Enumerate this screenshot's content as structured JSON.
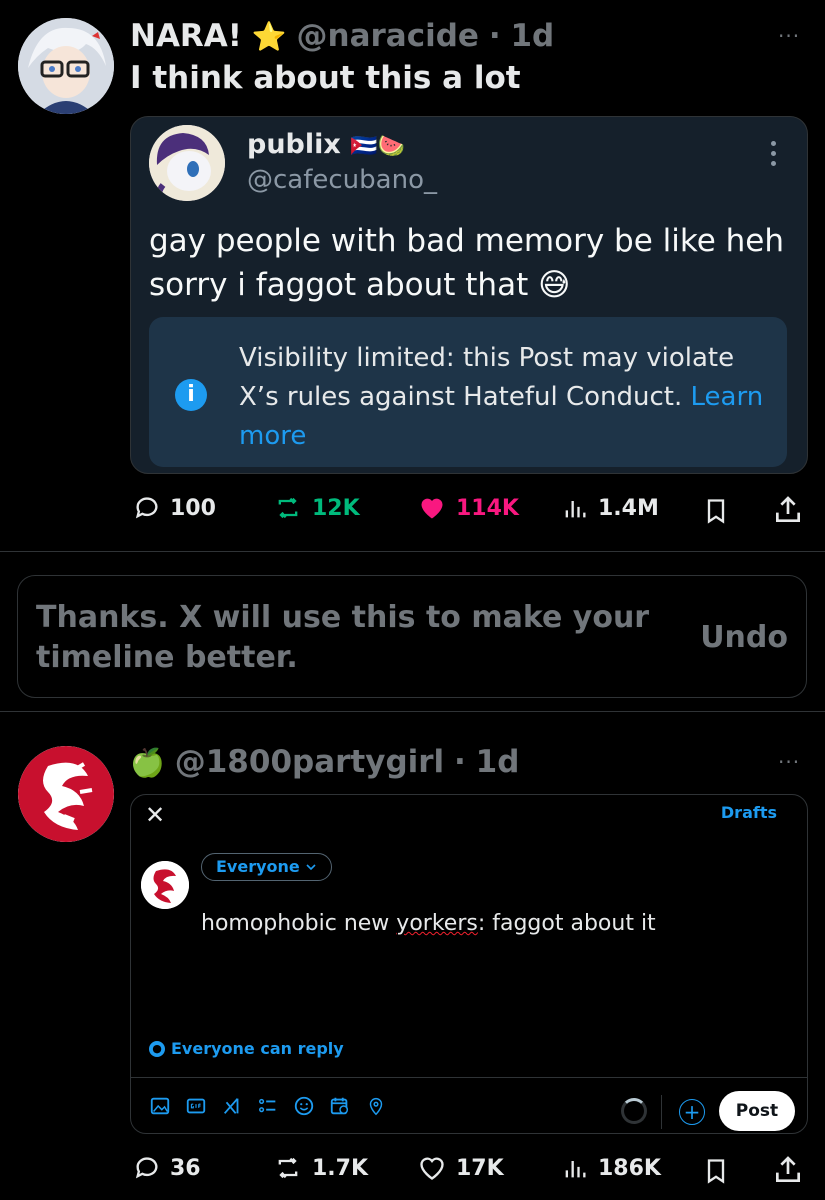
{
  "post1": {
    "author_name": "NARA!",
    "author_badge": "⭐",
    "handle": "@naracide",
    "separator": "·",
    "time": "1d",
    "more": "···",
    "text": "I think about this a lot",
    "quote": {
      "name": "publix",
      "name_emoji": "🇨🇺🍉",
      "handle": "@cafecubano_",
      "text": "gay people with bad memory be like heh sorry i faggot about that 😅",
      "notice_icon": "i",
      "notice_text": "Visibility limited: this Post may violate X’s rules against Hateful Conduct.",
      "notice_link": "Learn more"
    },
    "stats": {
      "replies": "100",
      "reposts": "12K",
      "likes": "114K",
      "views": "1.4M"
    }
  },
  "feedback": {
    "text": "Thanks. X will use this to make your timeline better.",
    "undo": "Undo"
  },
  "post2": {
    "author_emoji": "🍏",
    "handle": "@1800partygirl",
    "separator": "·",
    "time": "1d",
    "more": "···",
    "composer": {
      "close": "✕",
      "drafts": "Drafts",
      "audience": "Everyone",
      "text_before": "homophobic new ",
      "text_underlined": "yorkers",
      "text_after": ": faggot about it",
      "reply_setting": "Everyone can reply",
      "plus": "+",
      "post_button": "Post"
    },
    "stats": {
      "replies": "36",
      "reposts": "1.7K",
      "likes": "17K",
      "views": "186K"
    }
  },
  "colors": {
    "background": "#000000",
    "accent": "#1d9bf0",
    "like_active": "#f91880",
    "repost_active": "#00ba7c",
    "muted": "#71767b"
  }
}
